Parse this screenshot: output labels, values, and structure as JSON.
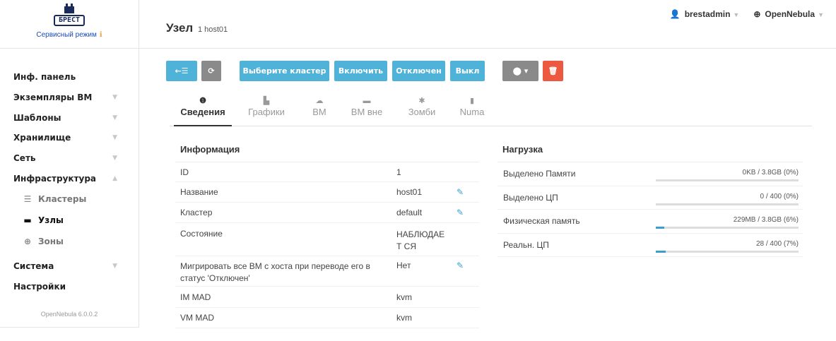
{
  "sidebar": {
    "logo_text": "БРЕСТ",
    "service_mode": "Сервисный режим",
    "service_mode_icon": "info-icon",
    "items": [
      {
        "label": "Инф. панель",
        "chevron": ""
      },
      {
        "label": "Экземпляры ВМ",
        "chevron": "▼"
      },
      {
        "label": "Шаблоны",
        "chevron": "▼"
      },
      {
        "label": "Хранилище",
        "chevron": "▼"
      },
      {
        "label": "Сеть",
        "chevron": "▼"
      },
      {
        "label": "Инфраструктура",
        "chevron": "▲"
      }
    ],
    "sub_items": [
      {
        "label": "Кластеры",
        "icon": "servers-icon"
      },
      {
        "label": "Узлы",
        "icon": "hdd-icon"
      },
      {
        "label": "Зоны",
        "icon": "globe-icon"
      }
    ],
    "bottom_items": [
      {
        "label": "Система",
        "chevron": "▼"
      },
      {
        "label": "Настройки",
        "chevron": ""
      }
    ],
    "version": "OpenNebula 6.0.0.2"
  },
  "header": {
    "title": "Узел",
    "subtitle": "1 host01",
    "user": "brestadmin",
    "zone": "OpenNebula"
  },
  "toolbar": {
    "back_icon": "back-list-icon",
    "refresh_icon": "refresh-icon",
    "select_cluster": "Выберите кластер",
    "enable": "Включить",
    "disable": "Отключен",
    "off": "Выкл",
    "labels_icon": "tags-icon",
    "delete_icon": "trash-icon"
  },
  "tabs": [
    {
      "label": "Сведения",
      "icon": "info-circle-icon"
    },
    {
      "label": "Графики",
      "icon": "bar-chart-icon"
    },
    {
      "label": "ВМ",
      "icon": "cloud-icon"
    },
    {
      "label": "ВМ вне",
      "icon": "hdd-icon"
    },
    {
      "label": "Зомби",
      "icon": "bug-icon"
    },
    {
      "label": "Numa",
      "icon": "microchip-icon"
    }
  ],
  "info": {
    "title": "Информация",
    "rows": [
      {
        "key": "ID",
        "value": "1"
      },
      {
        "key": "Название",
        "value": "host01"
      },
      {
        "key": "Кластер",
        "value": "default"
      },
      {
        "key": "Состояние",
        "value": "НАБЛЮДАЕТ СЯ"
      },
      {
        "key": "Мигрировать все ВМ с хоста при переводе его в статус 'Отключен'",
        "value": "Нет"
      },
      {
        "key": "IM MAD",
        "value": "kvm"
      },
      {
        "key": "VM MAD",
        "value": "kvm"
      }
    ]
  },
  "load": {
    "title": "Нагрузка",
    "rows": [
      {
        "label": "Выделено Памяти",
        "value": "0KB / 3.8GB (0%)",
        "percent": 0
      },
      {
        "label": "Выделено ЦП",
        "value": "0 / 400 (0%)",
        "percent": 0
      },
      {
        "label": "Физическая память",
        "value": "229MB / 3.8GB (6%)",
        "percent": 6
      },
      {
        "label": "Реальн. ЦП",
        "value": "28 / 400 (7%)",
        "percent": 7
      }
    ],
    "accent": "#3a9fd0"
  }
}
